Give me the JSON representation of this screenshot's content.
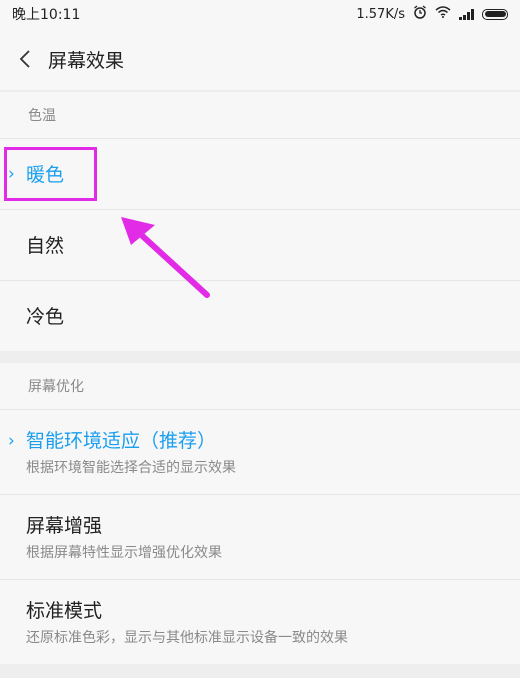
{
  "status_bar": {
    "time": "晚上10:11",
    "speed": "1.57K/s"
  },
  "header": {
    "title": "屏幕效果"
  },
  "color_temp_section": {
    "header": "色温",
    "items": [
      {
        "label": "暖色",
        "selected": true
      },
      {
        "label": "自然",
        "selected": false
      },
      {
        "label": "冷色",
        "selected": false
      }
    ]
  },
  "optimization_section": {
    "header": "屏幕优化",
    "items": [
      {
        "label": "智能环境适应（推荐）",
        "desc": "根据环境智能选择合适的显示效果",
        "selected": true
      },
      {
        "label": "屏幕增强",
        "desc": "根据屏幕特性显示增强优化效果",
        "selected": false
      },
      {
        "label": "标准模式",
        "desc": "还原标准色彩，显示与其他标准显示设备一致的效果",
        "selected": false
      }
    ]
  },
  "colors": {
    "accent": "#1a9ff0",
    "annotation": "#e22be6"
  },
  "icons": {
    "back": "back-icon",
    "alarm": "alarm-icon",
    "wifi": "wifi-icon",
    "signal": "signal-icon",
    "battery": "battery-icon",
    "selected": "chevron-right-icon"
  }
}
